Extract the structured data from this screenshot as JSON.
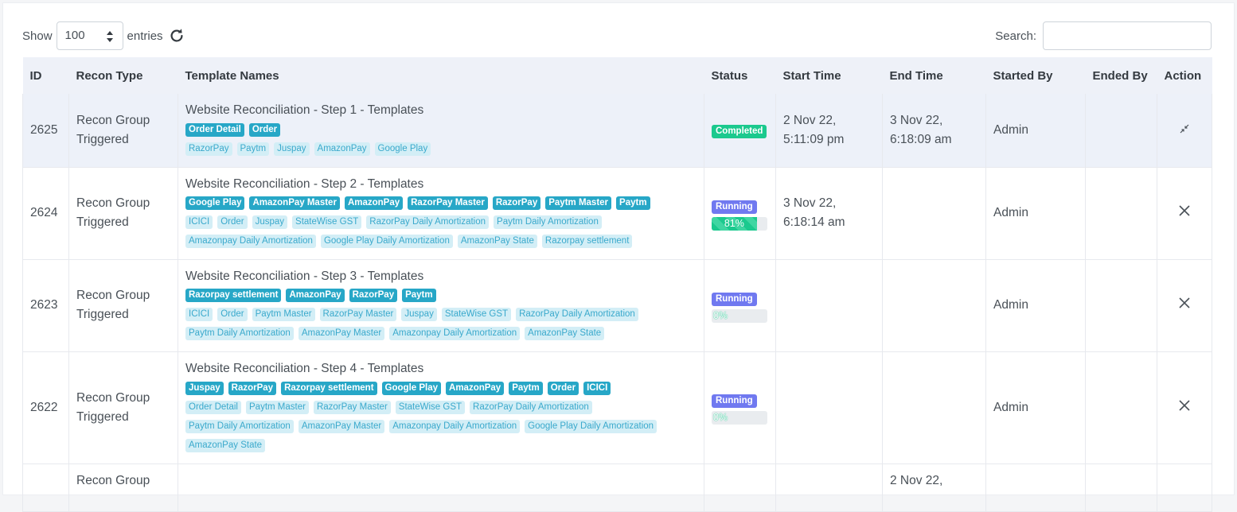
{
  "controls": {
    "show_label": "Show",
    "entries_value": "100",
    "entries_label": "entries",
    "search_label": "Search:",
    "search_value": "",
    "icons": {
      "refresh": "refresh-icon",
      "select_caret": "sort-caret-icon"
    }
  },
  "table": {
    "headers": {
      "id": "ID",
      "recon_type": "Recon Type",
      "template_names": "Template Names",
      "status": "Status",
      "start_time": "Start Time",
      "end_time": "End Time",
      "started_by": "Started By",
      "ended_by": "Ended By",
      "action": "Action"
    },
    "rows": [
      {
        "id": "2625",
        "recon_type_1": "Recon Group",
        "recon_type_2": "Triggered",
        "template_title": "Website Reconciliation - Step 1 - Templates",
        "dark_badges": [
          "Order Detail",
          "Order"
        ],
        "light_badges": [
          "RazorPay",
          "Paytm",
          "Juspay",
          "AmazonPay",
          "Google Play"
        ],
        "status": "Completed",
        "start_1": "2 Nov 22,",
        "start_2": "5:11:09 pm",
        "end_1": "3 Nov 22,",
        "end_2": "6:18:09 am",
        "started_by": "Admin",
        "ended_by": "",
        "action_icon": "collapse-icon"
      },
      {
        "id": "2624",
        "recon_type_1": "Recon Group",
        "recon_type_2": "Triggered",
        "template_title": "Website Reconciliation - Step 2 - Templates",
        "dark_badges": [
          "Google Play",
          "AmazonPay Master",
          "AmazonPay",
          "RazorPay Master",
          "RazorPay",
          "Paytm Master",
          "Paytm"
        ],
        "light_badges": [
          "ICICI",
          "Order",
          "Juspay",
          "StateWise GST",
          "RazorPay Daily Amortization",
          "Paytm Daily Amortization",
          "Amazonpay Daily Amortization",
          "Google Play Daily Amortization",
          "AmazonPay State",
          "Razorpay settlement"
        ],
        "status": "Running",
        "progress": 81,
        "progress_label": "81%",
        "start_1": "3 Nov 22,",
        "start_2": "6:18:14 am",
        "end_1": "",
        "end_2": "",
        "started_by": "Admin",
        "ended_by": "",
        "action_icon": "close-icon"
      },
      {
        "id": "2623",
        "recon_type_1": "Recon Group",
        "recon_type_2": "Triggered",
        "template_title": "Website Reconciliation - Step 3 - Templates",
        "dark_badges": [
          "Razorpay settlement",
          "AmazonPay",
          "RazorPay",
          "Paytm"
        ],
        "light_badges": [
          "ICICI",
          "Order",
          "Paytm Master",
          "RazorPay Master",
          "Juspay",
          "StateWise GST",
          "RazorPay Daily Amortization",
          "Paytm Daily Amortization",
          "AmazonPay Master",
          "Amazonpay Daily Amortization",
          "AmazonPay State"
        ],
        "status": "Running",
        "progress": 0,
        "progress_label": "0%",
        "start_1": "",
        "start_2": "",
        "end_1": "",
        "end_2": "",
        "started_by": "Admin",
        "ended_by": "",
        "action_icon": "close-icon"
      },
      {
        "id": "2622",
        "recon_type_1": "Recon Group",
        "recon_type_2": "Triggered",
        "template_title": "Website Reconciliation - Step 4 - Templates",
        "dark_badges": [
          "Juspay",
          "RazorPay",
          "Razorpay settlement",
          "Google Play",
          "AmazonPay",
          "Paytm",
          "Order",
          "ICICI"
        ],
        "light_badges": [
          "Order Detail",
          "Paytm Master",
          "RazorPay Master",
          "StateWise GST",
          "RazorPay Daily Amortization",
          "Paytm Daily Amortization",
          "AmazonPay Master",
          "Amazonpay Daily Amortization",
          "Google Play Daily Amortization",
          "AmazonPay State"
        ],
        "status": "Running",
        "progress": 0,
        "progress_label": "0%",
        "start_1": "",
        "start_2": "",
        "end_1": "",
        "end_2": "",
        "started_by": "Admin",
        "ended_by": "",
        "action_icon": "close-icon"
      },
      {
        "id": "",
        "recon_type_1": "Recon Group",
        "recon_type_2": "",
        "template_title": "",
        "dark_badges": [],
        "light_badges": [],
        "status": "",
        "start_1": "",
        "start_2": "",
        "end_1": "2 Nov 22,",
        "end_2": "",
        "started_by": "",
        "ended_by": "",
        "action_icon": ""
      }
    ]
  },
  "colors": {
    "badge_dark": "#27a7c7",
    "badge_light_bg": "#d3eef6",
    "status_completed": "#1bc98e",
    "status_running": "#7079f0",
    "header_bg": "#eef1f8",
    "highlight_row": "#edf1f9"
  }
}
